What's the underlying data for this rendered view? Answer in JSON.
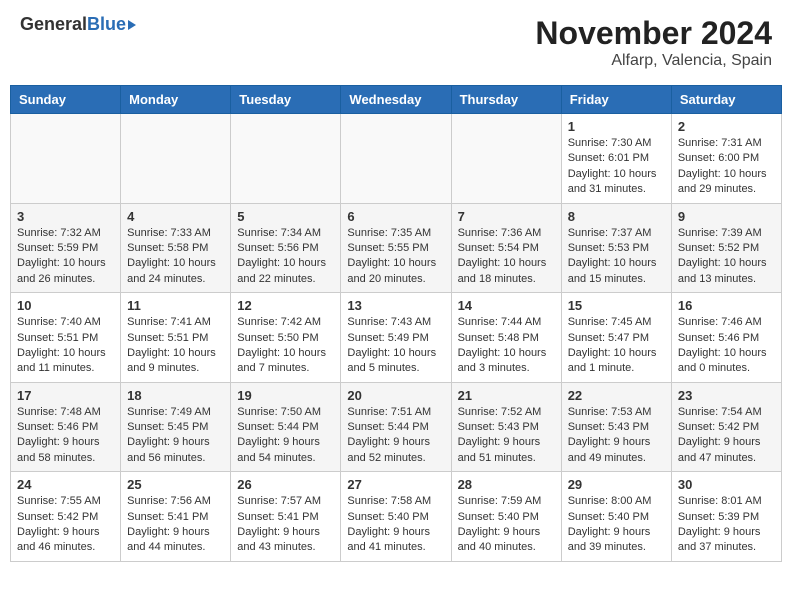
{
  "header": {
    "logo_general": "General",
    "logo_blue": "Blue",
    "title": "November 2024",
    "location": "Alfarp, Valencia, Spain"
  },
  "days_of_week": [
    "Sunday",
    "Monday",
    "Tuesday",
    "Wednesday",
    "Thursday",
    "Friday",
    "Saturday"
  ],
  "weeks": [
    [
      {
        "day": "",
        "info": ""
      },
      {
        "day": "",
        "info": ""
      },
      {
        "day": "",
        "info": ""
      },
      {
        "day": "",
        "info": ""
      },
      {
        "day": "",
        "info": ""
      },
      {
        "day": "1",
        "info": "Sunrise: 7:30 AM\nSunset: 6:01 PM\nDaylight: 10 hours and 31 minutes."
      },
      {
        "day": "2",
        "info": "Sunrise: 7:31 AM\nSunset: 6:00 PM\nDaylight: 10 hours and 29 minutes."
      }
    ],
    [
      {
        "day": "3",
        "info": "Sunrise: 7:32 AM\nSunset: 5:59 PM\nDaylight: 10 hours and 26 minutes."
      },
      {
        "day": "4",
        "info": "Sunrise: 7:33 AM\nSunset: 5:58 PM\nDaylight: 10 hours and 24 minutes."
      },
      {
        "day": "5",
        "info": "Sunrise: 7:34 AM\nSunset: 5:56 PM\nDaylight: 10 hours and 22 minutes."
      },
      {
        "day": "6",
        "info": "Sunrise: 7:35 AM\nSunset: 5:55 PM\nDaylight: 10 hours and 20 minutes."
      },
      {
        "day": "7",
        "info": "Sunrise: 7:36 AM\nSunset: 5:54 PM\nDaylight: 10 hours and 18 minutes."
      },
      {
        "day": "8",
        "info": "Sunrise: 7:37 AM\nSunset: 5:53 PM\nDaylight: 10 hours and 15 minutes."
      },
      {
        "day": "9",
        "info": "Sunrise: 7:39 AM\nSunset: 5:52 PM\nDaylight: 10 hours and 13 minutes."
      }
    ],
    [
      {
        "day": "10",
        "info": "Sunrise: 7:40 AM\nSunset: 5:51 PM\nDaylight: 10 hours and 11 minutes."
      },
      {
        "day": "11",
        "info": "Sunrise: 7:41 AM\nSunset: 5:51 PM\nDaylight: 10 hours and 9 minutes."
      },
      {
        "day": "12",
        "info": "Sunrise: 7:42 AM\nSunset: 5:50 PM\nDaylight: 10 hours and 7 minutes."
      },
      {
        "day": "13",
        "info": "Sunrise: 7:43 AM\nSunset: 5:49 PM\nDaylight: 10 hours and 5 minutes."
      },
      {
        "day": "14",
        "info": "Sunrise: 7:44 AM\nSunset: 5:48 PM\nDaylight: 10 hours and 3 minutes."
      },
      {
        "day": "15",
        "info": "Sunrise: 7:45 AM\nSunset: 5:47 PM\nDaylight: 10 hours and 1 minute."
      },
      {
        "day": "16",
        "info": "Sunrise: 7:46 AM\nSunset: 5:46 PM\nDaylight: 10 hours and 0 minutes."
      }
    ],
    [
      {
        "day": "17",
        "info": "Sunrise: 7:48 AM\nSunset: 5:46 PM\nDaylight: 9 hours and 58 minutes."
      },
      {
        "day": "18",
        "info": "Sunrise: 7:49 AM\nSunset: 5:45 PM\nDaylight: 9 hours and 56 minutes."
      },
      {
        "day": "19",
        "info": "Sunrise: 7:50 AM\nSunset: 5:44 PM\nDaylight: 9 hours and 54 minutes."
      },
      {
        "day": "20",
        "info": "Sunrise: 7:51 AM\nSunset: 5:44 PM\nDaylight: 9 hours and 52 minutes."
      },
      {
        "day": "21",
        "info": "Sunrise: 7:52 AM\nSunset: 5:43 PM\nDaylight: 9 hours and 51 minutes."
      },
      {
        "day": "22",
        "info": "Sunrise: 7:53 AM\nSunset: 5:43 PM\nDaylight: 9 hours and 49 minutes."
      },
      {
        "day": "23",
        "info": "Sunrise: 7:54 AM\nSunset: 5:42 PM\nDaylight: 9 hours and 47 minutes."
      }
    ],
    [
      {
        "day": "24",
        "info": "Sunrise: 7:55 AM\nSunset: 5:42 PM\nDaylight: 9 hours and 46 minutes."
      },
      {
        "day": "25",
        "info": "Sunrise: 7:56 AM\nSunset: 5:41 PM\nDaylight: 9 hours and 44 minutes."
      },
      {
        "day": "26",
        "info": "Sunrise: 7:57 AM\nSunset: 5:41 PM\nDaylight: 9 hours and 43 minutes."
      },
      {
        "day": "27",
        "info": "Sunrise: 7:58 AM\nSunset: 5:40 PM\nDaylight: 9 hours and 41 minutes."
      },
      {
        "day": "28",
        "info": "Sunrise: 7:59 AM\nSunset: 5:40 PM\nDaylight: 9 hours and 40 minutes."
      },
      {
        "day": "29",
        "info": "Sunrise: 8:00 AM\nSunset: 5:40 PM\nDaylight: 9 hours and 39 minutes."
      },
      {
        "day": "30",
        "info": "Sunrise: 8:01 AM\nSunset: 5:39 PM\nDaylight: 9 hours and 37 minutes."
      }
    ]
  ]
}
